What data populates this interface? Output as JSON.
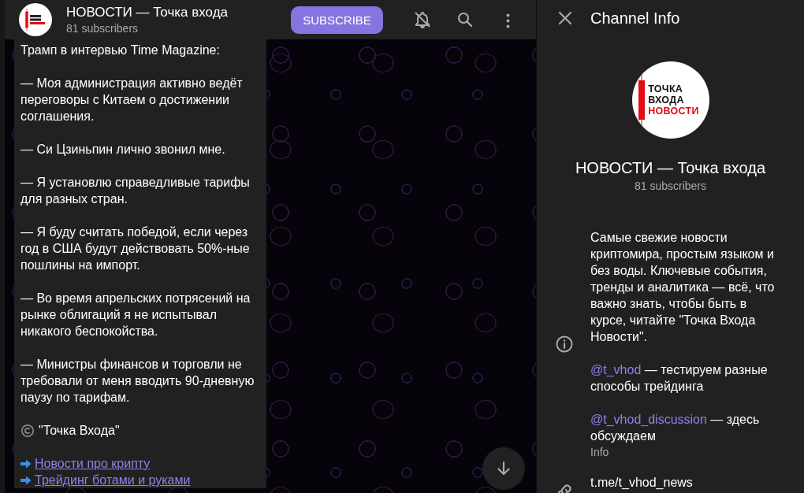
{
  "header": {
    "title": "НОВОСТИ — Точка входа",
    "subtitle": "81 subscribers",
    "subscribe_button": "SUBSCRIBE",
    "muted": true
  },
  "message": {
    "paragraphs": [
      {
        "kind": "text",
        "text": "Трамп в интервью Time Magazine:"
      },
      {
        "kind": "text",
        "text": "— Моя администрация активно ведёт переговоры с Китаем о достижении соглашения."
      },
      {
        "kind": "text",
        "text": "— Си Цзиньпин лично звонил мне."
      },
      {
        "kind": "text",
        "text": "— Я установлю справедливые тарифы для разных стран."
      },
      {
        "kind": "text",
        "text": "— Я буду считать победой, если через год в США будут действовать 50%-ные пошлины на импорт."
      },
      {
        "kind": "text",
        "text": "— Во время апрельских потрясений на рынке облигаций я не испытывал никакого беспокойства."
      },
      {
        "kind": "text",
        "text": "— Министры финансов и торговли не требовали от меня вводить 90-дневную паузу по тарифам."
      },
      {
        "kind": "signature",
        "text": "\"Точка Входа\""
      },
      {
        "kind": "links",
        "links": [
          "Новости про крипту",
          "Трейдинг ботами и руками"
        ]
      }
    ]
  },
  "panel": {
    "title": "Channel Info",
    "avatar_lines": [
      "ТОЧКА",
      "ВХОДА",
      "НОВОСТИ"
    ],
    "name": "НОВОСТИ — Точка входа",
    "subscribers": "81 subscribers",
    "info": {
      "paragraphs": [
        {
          "text": "Самые свежие новости криптомира, простым языком и без воды. Ключевые события, тренды и аналитика — всё, что важно знать, чтобы быть в курсе, читайте \"Точка Входа Новости\"."
        },
        {
          "link": "@t_vhod",
          "text": " — тестируем разные способы трейдинга"
        },
        {
          "link": "@t_vhod_discussion",
          "text": " — здесь обсуждаем"
        }
      ],
      "label": "Info"
    },
    "link": {
      "value": "t.me/t_vhod_news"
    }
  }
}
